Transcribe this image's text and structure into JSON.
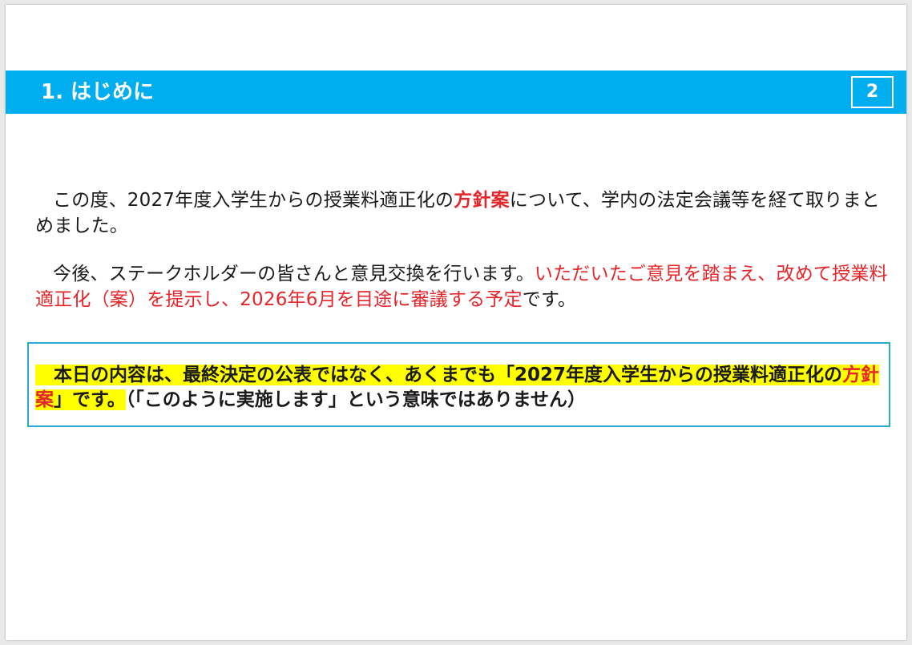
{
  "slide": {
    "title": "1. はじめに",
    "page_number": "2"
  },
  "paragraph1": {
    "part1": "この度、2027年度入学生からの授業料適正化の",
    "emph": "方針案",
    "part2": "について、学内の法定会議等を経て取りまとめました。"
  },
  "paragraph2": {
    "part1": "今後、ステークホルダーの皆さんと意見交換を行います。",
    "red": "いただいたご意見を踏まえ、改めて授業料適正化（案）を提示し、2026年6月を目途に審議する予定",
    "part2": "です。"
  },
  "callout": {
    "part1": "本日の内容は、最終決定の公表ではなく、あくまでも「2027年度入学生からの授業料適正化の",
    "emph": "方針案",
    "part2": "」です。",
    "note": "（「このように実施します」という意味ではありません）"
  },
  "colors": {
    "title_bar": "#00aeef",
    "emphasis_red": "#e5252a",
    "highlight": "#ffff00",
    "callout_border": "#29a9d6"
  }
}
